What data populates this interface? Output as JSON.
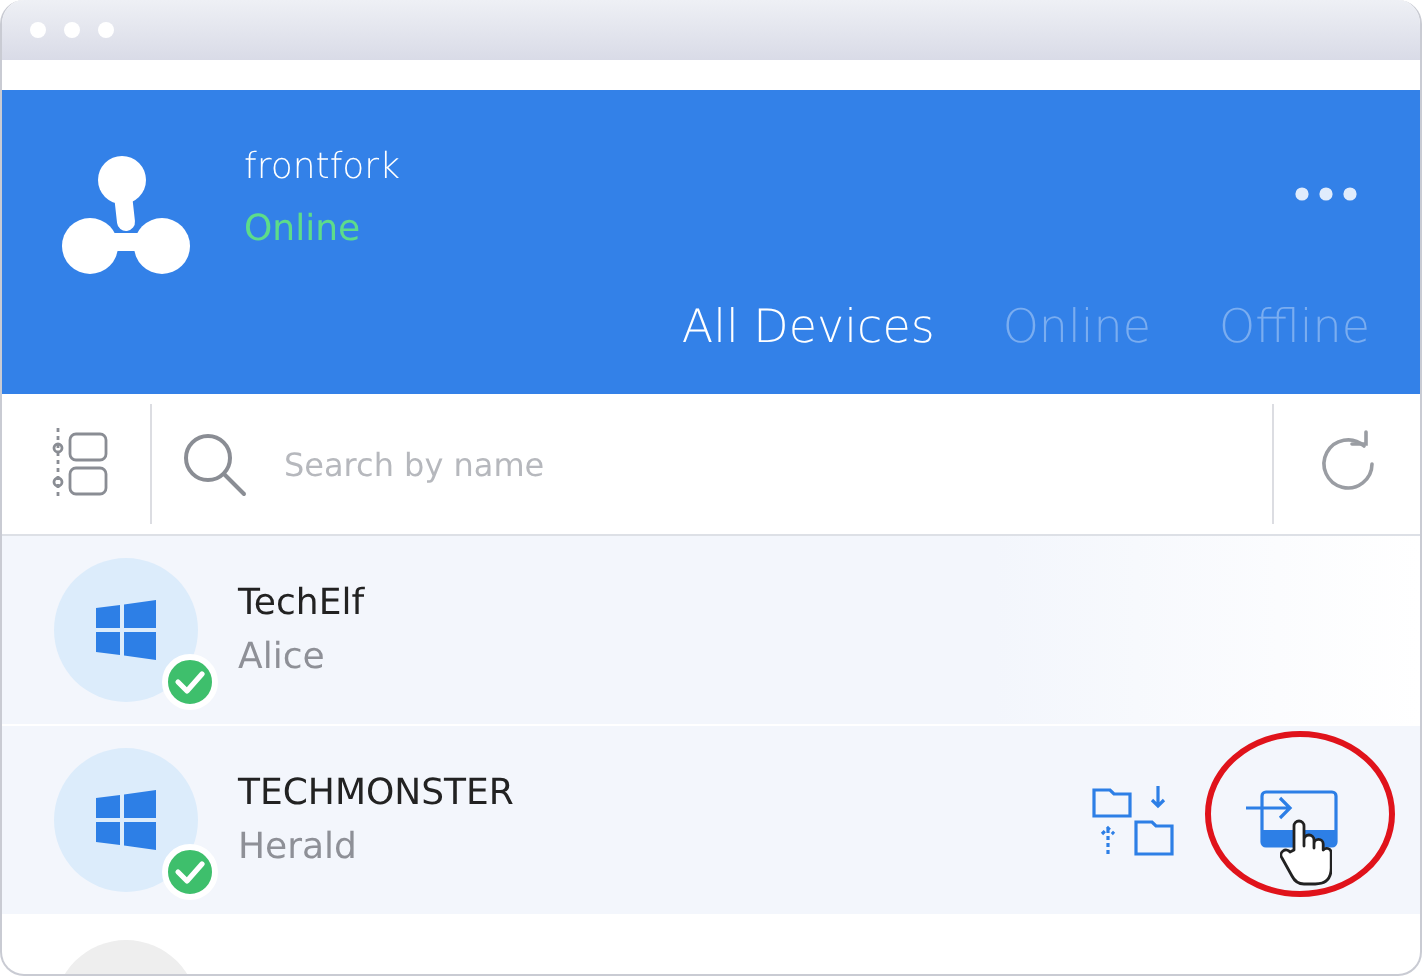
{
  "account": {
    "name": "frontfork",
    "status": "Online"
  },
  "tabs": [
    {
      "label": "All Devices",
      "selected": true
    },
    {
      "label": "Online",
      "selected": false
    },
    {
      "label": "Offline",
      "selected": false
    }
  ],
  "search": {
    "placeholder": "Search by name"
  },
  "devices": [
    {
      "name": "TechElf",
      "user": "Alice",
      "online": true,
      "hovered": false,
      "annotated": false
    },
    {
      "name": "TECHMONSTER",
      "user": "Herald",
      "online": true,
      "hovered": true,
      "annotated": true
    }
  ]
}
